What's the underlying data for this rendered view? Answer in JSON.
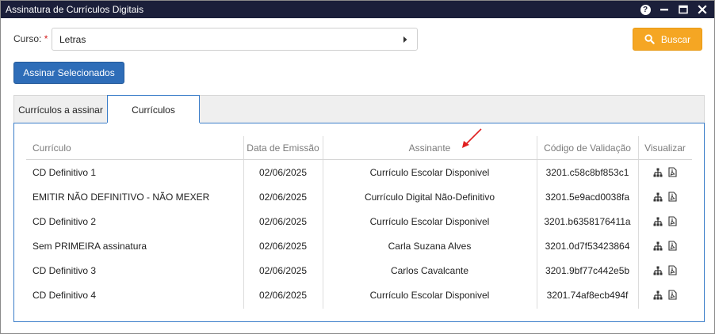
{
  "window": {
    "title": "Assinatura de Currículos Digitais",
    "help_symbol": "?"
  },
  "filters": {
    "curso_label": "Curso:",
    "required_mark": "*",
    "curso_value": "Letras",
    "search_label": "Buscar"
  },
  "actions": {
    "sign_selected_label": "Assinar Selecionados"
  },
  "tabs": [
    {
      "label": "Currículos a assinar",
      "active": false
    },
    {
      "label": "Currículos",
      "active": true
    }
  ],
  "table": {
    "columns": [
      "Currículo",
      "Data de Emissão",
      "Assinante",
      "Código de Validação",
      "Visualizar"
    ],
    "rows": [
      {
        "curriculo": "CD Definitivo 1",
        "data": "02/06/2025",
        "assinante": "Currículo Escolar Disponivel",
        "codigo": "3201.c58c8bf853c1"
      },
      {
        "curriculo": "EMITIR NÃO DEFINITIVO - NÃO MEXER",
        "data": "02/06/2025",
        "assinante": "Currículo Digital Não-Definitivo",
        "codigo": "3201.5e9acd0038fa"
      },
      {
        "curriculo": "CD Definitivo 2",
        "data": "02/06/2025",
        "assinante": "Currículo Escolar Disponivel",
        "codigo": "3201.b6358176411a"
      },
      {
        "curriculo": "Sem PRIMEIRA assinatura",
        "data": "02/06/2025",
        "assinante": "Carla Suzana Alves",
        "codigo": "3201.0d7f53423864"
      },
      {
        "curriculo": "CD Definitivo 3",
        "data": "02/06/2025",
        "assinante": "Carlos Cavalcante",
        "codigo": "3201.9bf77c442e5b"
      },
      {
        "curriculo": "CD Definitivo 4",
        "data": "02/06/2025",
        "assinante": "Currículo Escolar Disponivel",
        "codigo": "3201.74af8ecb494f"
      }
    ],
    "row_icons": [
      "hierarchy-icon",
      "pdf-icon"
    ]
  },
  "colors": {
    "titlebar": "#1b1f3a",
    "primary_button": "#2e6db8",
    "search_button": "#f5a623",
    "active_tab_border": "#3a7dc9",
    "annotation_arrow": "#e02020"
  }
}
